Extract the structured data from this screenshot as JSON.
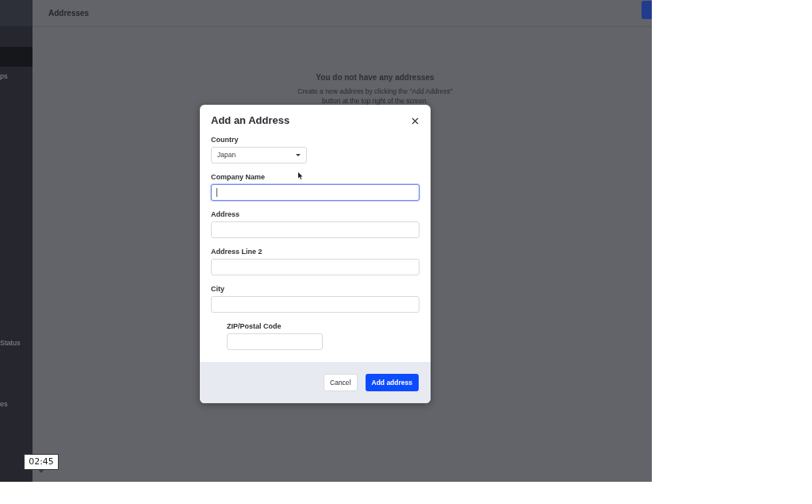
{
  "sidebar": {
    "items": [
      {
        "selected": true
      },
      {
        "label": "ps",
        "selected": false
      },
      {
        "label": "Status",
        "selected": false
      },
      {
        "label": "es",
        "selected": false
      }
    ]
  },
  "header": {
    "title": "Addresses"
  },
  "empty_state": {
    "title": "You do not have any addresses",
    "message": "Create a new address by clicking the \"Add Address\" button at the top right of the screen."
  },
  "dialog": {
    "title": "Add an Address",
    "fields": [
      {
        "kind": "select",
        "label": "Country",
        "value": "Japan"
      },
      {
        "kind": "text",
        "label": "Company Name",
        "focused": true
      },
      {
        "kind": "text",
        "label": "Address",
        "focused": false
      },
      {
        "kind": "text",
        "label": "Address Line 2",
        "focused": false
      },
      {
        "kind": "text",
        "label": "City",
        "focused": false
      },
      {
        "kind": "short",
        "label": "ZIP/Postal Code",
        "focused": false
      }
    ],
    "buttons": [
      {
        "kind": "secondary",
        "label": "Cancel"
      },
      {
        "kind": "primary",
        "label": "Add address"
      }
    ]
  },
  "video": {
    "time": "02:45"
  }
}
